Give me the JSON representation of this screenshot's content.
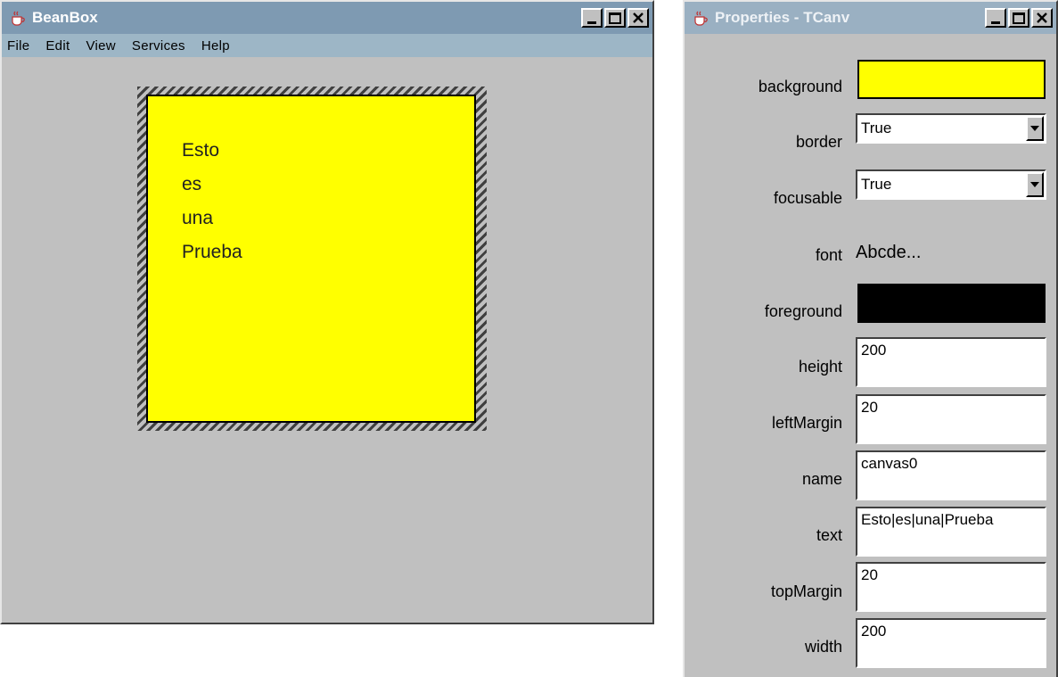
{
  "beanbox": {
    "title": "BeanBox",
    "menu": [
      "File",
      "Edit",
      "View",
      "Services",
      "Help"
    ],
    "canvas_lines": [
      "Esto",
      "es",
      "una",
      "Prueba"
    ]
  },
  "properties": {
    "title": "Properties - TCanv",
    "background": {
      "label": "background",
      "color": "#ffff00"
    },
    "border": {
      "label": "border",
      "value": "True"
    },
    "focusable": {
      "label": "focusable",
      "value": "True"
    },
    "font": {
      "label": "font",
      "preview": "Abcde..."
    },
    "foreground": {
      "label": "foreground",
      "color": "#000000"
    },
    "height": {
      "label": "height",
      "value": "200"
    },
    "leftMargin": {
      "label": "leftMargin",
      "value": "20"
    },
    "name": {
      "label": "name",
      "value": "canvas0"
    },
    "text": {
      "label": "text",
      "value": "Esto|es|una|Prueba"
    },
    "topMargin": {
      "label": "topMargin",
      "value": "20"
    },
    "width": {
      "label": "width",
      "value": "200"
    }
  },
  "icons": {
    "app_icon": "java-cup-icon",
    "minimize": "minimize-icon",
    "maximize": "maximize-icon",
    "close": "close-icon",
    "dropdown": "chevron-down-icon"
  }
}
